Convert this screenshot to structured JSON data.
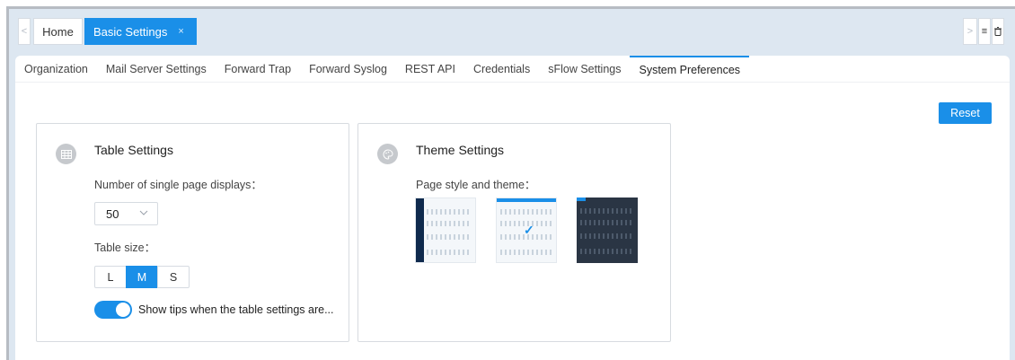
{
  "topbar": {
    "home_tab": "Home",
    "active_tab": "Basic Settings",
    "close_symbol": "×",
    "prev_symbol": "<",
    "next_symbol": ">",
    "menu_symbol": "≡",
    "trash_symbol": "🗑"
  },
  "subtabs": [
    {
      "label": "Organization"
    },
    {
      "label": "Mail Server Settings"
    },
    {
      "label": "Forward Trap"
    },
    {
      "label": "Forward Syslog"
    },
    {
      "label": "REST API"
    },
    {
      "label": "Credentials"
    },
    {
      "label": "sFlow Settings"
    },
    {
      "label": "System Preferences"
    }
  ],
  "active_subtab": "System Preferences",
  "reset_label": "Reset",
  "table_settings": {
    "title": "Table Settings",
    "page_displays_label": "Number of single page displays：",
    "page_displays_value": "50",
    "table_size_label": "Table size：",
    "sizes": [
      "L",
      "M",
      "S"
    ],
    "selected_size": "M",
    "tips_toggle_label": "Show tips when the table settings are...",
    "tips_enabled": true
  },
  "theme_settings": {
    "title": "Theme Settings",
    "style_label": "Page style and theme：",
    "themes": [
      "dark-sidebar",
      "light",
      "dark"
    ],
    "selected_theme": "light"
  },
  "colors": {
    "accent": "#1a8fe8",
    "frame_bg": "#dde7f1"
  }
}
